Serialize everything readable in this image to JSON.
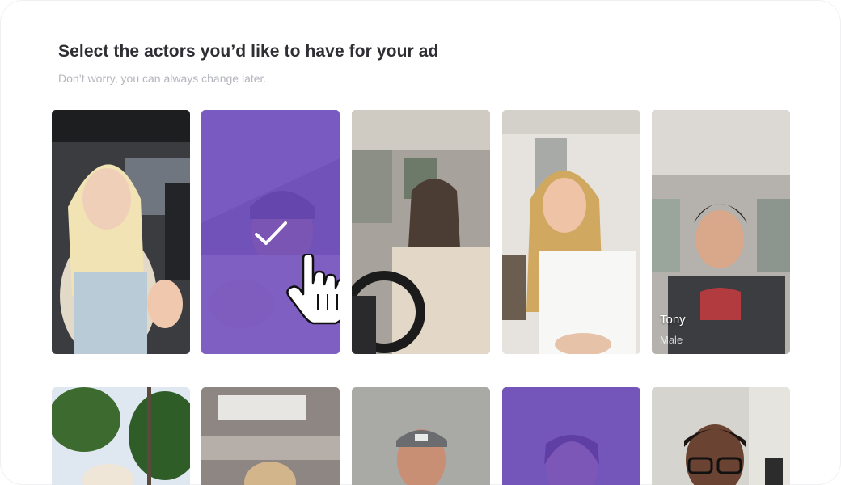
{
  "header": {
    "title": "Select the actors you’d like to have for your ad",
    "subtitle": "Don’t worry, you can always change later."
  },
  "actors_row1": [
    {
      "id": "actor-1",
      "selected": false,
      "name": "",
      "gender": ""
    },
    {
      "id": "actor-2",
      "selected": true,
      "name": "",
      "gender": ""
    },
    {
      "id": "actor-3",
      "selected": false,
      "name": "",
      "gender": ""
    },
    {
      "id": "actor-4",
      "selected": false,
      "name": "",
      "gender": ""
    },
    {
      "id": "actor-5",
      "selected": false,
      "name": "Tony",
      "gender": "Male"
    }
  ],
  "actors_row2": [
    {
      "id": "actor-6",
      "selected": false
    },
    {
      "id": "actor-7",
      "selected": false
    },
    {
      "id": "actor-8",
      "selected": false
    },
    {
      "id": "actor-9",
      "selected": true
    },
    {
      "id": "actor-10",
      "selected": false
    }
  ],
  "colors": {
    "accent": "#6b46c1",
    "title": "#2e2e33",
    "subtitle": "#b4b6bd"
  },
  "icons": {
    "selected": "checkmark-icon",
    "pointer": "hand-pointer-icon"
  }
}
